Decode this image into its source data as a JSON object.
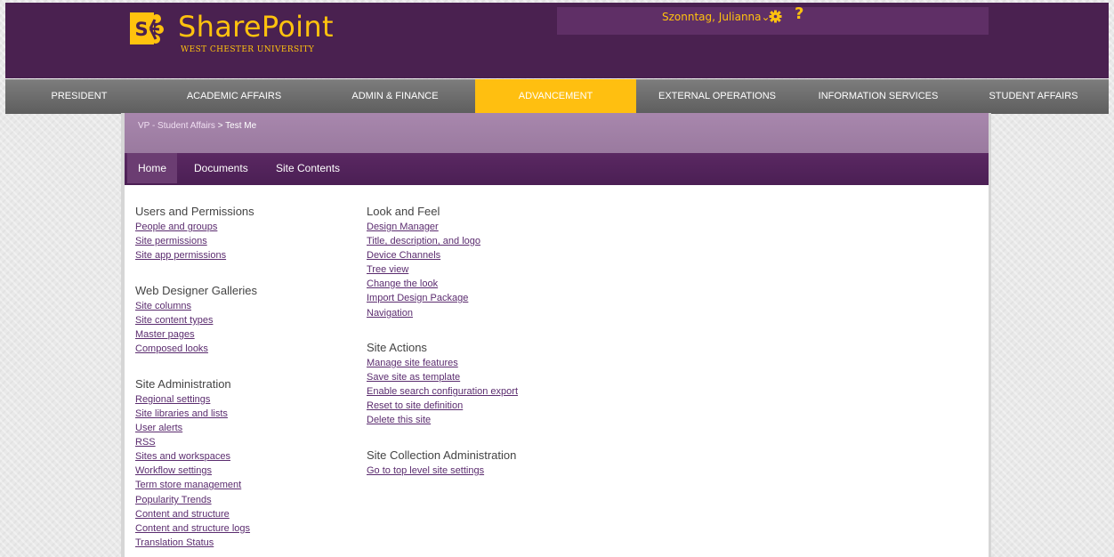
{
  "header": {
    "logo_letter": "S",
    "logo_text": "SharePoint",
    "logo_subtitle": "WEST CHESTER UNIVERSITY",
    "user_name": "Szonntag, Julianna",
    "user_chevron": "⌄",
    "help_label": "?",
    "accent_color": "#ffc20e",
    "header_color": "#4a2150"
  },
  "top_nav": {
    "items": [
      {
        "label": "PRESIDENT",
        "active": false
      },
      {
        "label": "ACADEMIC AFFAIRS",
        "active": false
      },
      {
        "label": "ADMIN & FINANCE",
        "active": false
      },
      {
        "label": "ADVANCEMENT",
        "active": true
      },
      {
        "label": "EXTERNAL OPERATIONS",
        "active": false
      },
      {
        "label": "INFORMATION SERVICES",
        "active": false
      },
      {
        "label": "STUDENT AFFAIRS",
        "active": false
      }
    ]
  },
  "breadcrumb": {
    "parent": "VP - Student Affairs",
    "separator": ">",
    "current": "Test Me"
  },
  "site_nav": {
    "items": [
      {
        "label": "Home",
        "active": true
      },
      {
        "label": "Documents",
        "active": false
      },
      {
        "label": "Site Contents",
        "active": false
      }
    ]
  },
  "settings": {
    "users_permissions": {
      "title": "Users and Permissions",
      "links": [
        "People and groups",
        "Site permissions",
        "Site app permissions"
      ]
    },
    "web_designer": {
      "title": "Web Designer Galleries",
      "links": [
        "Site columns",
        "Site content types",
        "Master pages",
        "Composed looks"
      ]
    },
    "site_admin": {
      "title": "Site Administration",
      "links": [
        "Regional settings",
        "Site libraries and lists",
        "User alerts",
        "RSS",
        "Sites and workspaces",
        "Workflow settings",
        "Term store management",
        "Popularity Trends",
        "Content and structure",
        "Content and structure logs",
        "Translation Status"
      ]
    },
    "look_feel": {
      "title": "Look and Feel",
      "links": [
        "Design Manager",
        "Title, description, and logo",
        "Device Channels",
        "Tree view",
        "Change the look",
        "Import Design Package",
        "Navigation"
      ]
    },
    "site_actions": {
      "title": "Site Actions",
      "links": [
        "Manage site features",
        "Save site as template",
        "Enable search configuration export",
        "Reset to site definition",
        "Delete this site"
      ]
    },
    "site_collection": {
      "title": "Site Collection Administration",
      "links": [
        "Go to top level site settings"
      ]
    }
  }
}
